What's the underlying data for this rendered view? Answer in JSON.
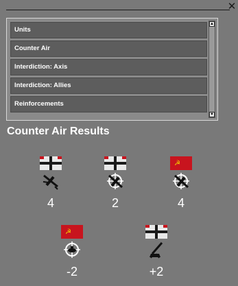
{
  "window": {
    "close_glyph": "✕"
  },
  "list": {
    "items": [
      {
        "label": "Units"
      },
      {
        "label": "Counter Air"
      },
      {
        "label": "Interdiction: Axis"
      },
      {
        "label": "Interdiction: Allies"
      },
      {
        "label": "Reinforcements"
      }
    ],
    "scroll_up_glyph": "▲",
    "scroll_down_glyph": "▼"
  },
  "results": {
    "title": "Counter Air Results",
    "rows": [
      [
        {
          "flag": "german-flag",
          "icon": "fighter-plane-icon",
          "value": "4"
        },
        {
          "flag": "german-flag",
          "icon": "fighter-targeted-icon",
          "value": "2"
        },
        {
          "flag": "soviet-flag",
          "icon": "fighter-targeted-icon",
          "value": "4"
        }
      ],
      [
        {
          "flag": "soviet-flag",
          "icon": "crosshair-target-icon",
          "value": "-2"
        },
        {
          "flag": "german-flag",
          "icon": "anti-aircraft-gun-icon",
          "value": "+2"
        }
      ]
    ]
  },
  "colors": {
    "panel": "#797979",
    "item_bg": "#5d5d5d",
    "text": "#ffffff",
    "soviet_red": "#c8141e",
    "german_black": "#1a1a1a"
  }
}
